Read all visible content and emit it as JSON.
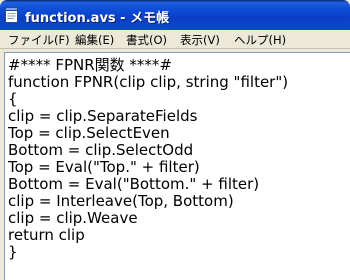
{
  "window": {
    "title": "function.avs - メモ帳",
    "icon": "notepad-icon"
  },
  "menu": {
    "items": [
      {
        "label": "ファイル(F)"
      },
      {
        "label": "編集(E)"
      },
      {
        "label": "書式(O)"
      },
      {
        "label": "表示(V)"
      },
      {
        "label": "ヘルプ(H)"
      }
    ]
  },
  "editor": {
    "lines": [
      "#**** FPNR関数 ****#",
      "function FPNR(clip clip, string \"filter\")",
      "{",
      "clip = clip.SeparateFields",
      "Top = clip.SelectEven",
      "Bottom = clip.SelectOdd",
      "Top = Eval(\"Top.\" + filter)",
      "Bottom = Eval(\"Bottom.\" + filter)",
      "clip = Interleave(Top, Bottom)",
      "clip = clip.Weave",
      "return clip",
      "}"
    ]
  }
}
